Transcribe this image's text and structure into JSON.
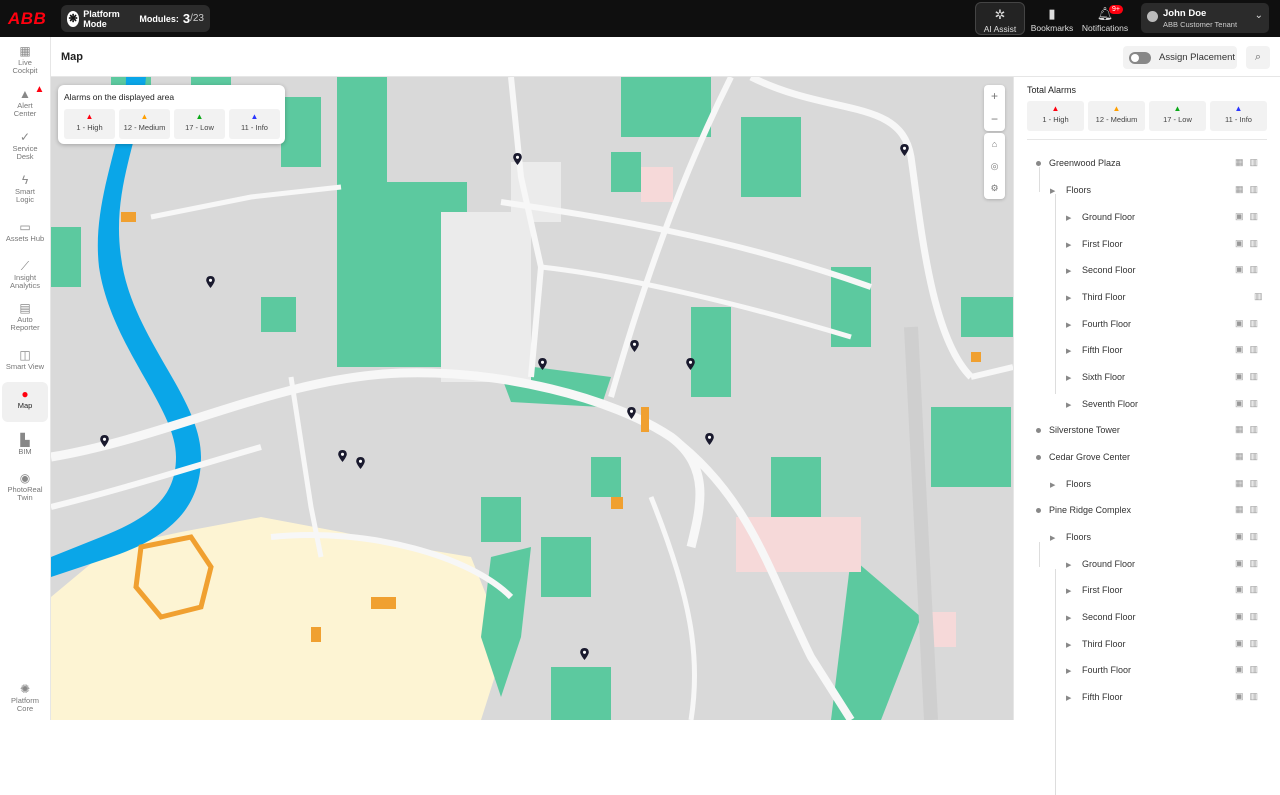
{
  "brand": {
    "logo": "ABB"
  },
  "topbar": {
    "mode_label": "Platform Mode",
    "modules_label": "Modules:",
    "modules_current": "3",
    "modules_total": "/23",
    "ai_assist": "AI Assist",
    "bookmarks": "Bookmarks",
    "notifications": "Notifications",
    "notifications_badge": "9+",
    "user_name": "John Doe",
    "user_tenant": "ABB Customer Tenant"
  },
  "sidebar": {
    "items": [
      {
        "label_1": "Live",
        "label_2": "Cockpit",
        "icon": "dashboard-icon"
      },
      {
        "label_1": "Alert",
        "label_2": "Center",
        "icon": "alert-icon"
      },
      {
        "label_1": "Service",
        "label_2": "Desk",
        "icon": "service-icon"
      },
      {
        "label_1": "Smart",
        "label_2": "Logic",
        "icon": "bolt-icon"
      },
      {
        "label_1": "Assets Hub",
        "label_2": "",
        "icon": "assets-icon"
      },
      {
        "label_1": "Insight",
        "label_2": "Analytics",
        "icon": "analytics-icon"
      },
      {
        "label_1": "Auto",
        "label_2": "Reporter",
        "icon": "report-icon"
      },
      {
        "label_1": "Smart View",
        "label_2": "",
        "icon": "view-icon"
      },
      {
        "label_1": "Map",
        "label_2": "",
        "icon": "map-pin-icon"
      },
      {
        "label_1": "BIM",
        "label_2": "",
        "icon": "bim-icon"
      },
      {
        "label_1": "PhotoReal",
        "label_2": "Twin",
        "icon": "camera-icon"
      },
      {
        "label_1": "Platform",
        "label_2": "Core",
        "icon": "core-icon"
      }
    ]
  },
  "header": {
    "title": "Map",
    "assign_placement": "Assign Placement"
  },
  "map_legend": {
    "title": "Alarms on the displayed area",
    "items": [
      {
        "label": "1 - High",
        "color": "#ff000f"
      },
      {
        "label": "12 - Medium",
        "color": "#ff9f00"
      },
      {
        "label": "17 - Low",
        "color": "#0ca919"
      },
      {
        "label": "11 - Info",
        "color": "#2a35ff"
      }
    ]
  },
  "total_alarms": {
    "title": "Total Alarms",
    "items": [
      {
        "label": "1 - High",
        "color": "#ff000f"
      },
      {
        "label": "12 - Medium",
        "color": "#ff9f00"
      },
      {
        "label": "17 - Low",
        "color": "#0ca919"
      },
      {
        "label": "11 - Info",
        "color": "#2a35ff"
      }
    ]
  },
  "tree": [
    {
      "label": "Greenwood Plaza",
      "level": 0
    },
    {
      "label": "Floors",
      "level": 1
    },
    {
      "label": "Ground Floor",
      "level": 2
    },
    {
      "label": "First Floor",
      "level": 2
    },
    {
      "label": "Second Floor",
      "level": 2
    },
    {
      "label": "Third Floor",
      "level": 2
    },
    {
      "label": "Fourth Floor",
      "level": 2
    },
    {
      "label": "Fifth Floor",
      "level": 2
    },
    {
      "label": "Sixth Floor",
      "level": 2
    },
    {
      "label": "Seventh Floor",
      "level": 2
    },
    {
      "label": "Silverstone Tower",
      "level": 0
    },
    {
      "label": "Cedar Grove Center",
      "level": 0
    },
    {
      "label": "Floors",
      "level": 1
    },
    {
      "label": "Pine Ridge Complex",
      "level": 0
    },
    {
      "label": "Floors",
      "level": 1
    },
    {
      "label": "Ground Floor",
      "level": 2
    },
    {
      "label": "First Floor",
      "level": 2
    },
    {
      "label": "Second Floor",
      "level": 2
    },
    {
      "label": "Third Floor",
      "level": 2
    },
    {
      "label": "Fourth Floor",
      "level": 2
    },
    {
      "label": "Fifth Floor",
      "level": 2
    }
  ]
}
